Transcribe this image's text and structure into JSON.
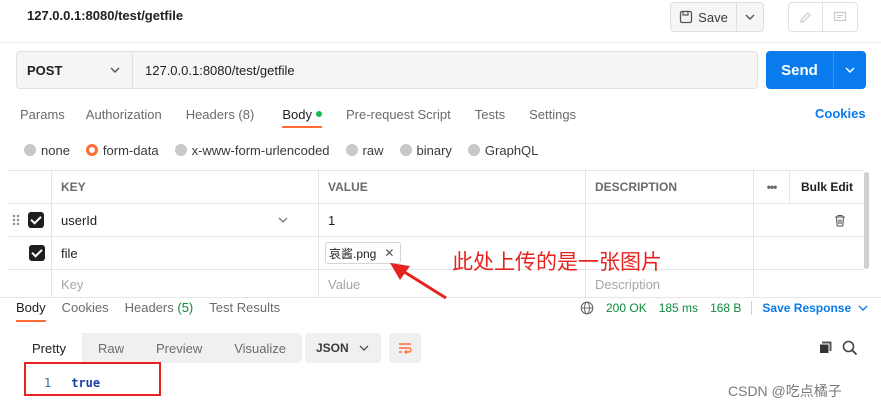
{
  "header": {
    "title": "127.0.0.1:8080/test/getfile",
    "save_label": "Save"
  },
  "request": {
    "method": "POST",
    "url": "127.0.0.1:8080/test/getfile",
    "send_label": "Send"
  },
  "tabs": {
    "items": [
      "Params",
      "Authorization",
      "Headers (8)",
      "Body",
      "Pre-request Script",
      "Tests",
      "Settings"
    ],
    "active": "Body",
    "cookies": "Cookies"
  },
  "body_modes": {
    "items": [
      "none",
      "form-data",
      "x-www-form-urlencoded",
      "raw",
      "binary",
      "GraphQL"
    ],
    "selected": "form-data"
  },
  "table": {
    "headers": {
      "key": "KEY",
      "value": "VALUE",
      "description": "DESCRIPTION",
      "more": "•••",
      "bulk": "Bulk Edit"
    },
    "rows": [
      {
        "key": "userId",
        "value": "1",
        "description": ""
      },
      {
        "key": "file",
        "value": "哀酱.png",
        "description": ""
      }
    ],
    "placeholder": {
      "key": "Key",
      "value": "Value",
      "description": "Description"
    }
  },
  "response": {
    "tabs": [
      "Body",
      "Cookies",
      "Headers",
      "Test Results"
    ],
    "headers_count": "(5)",
    "status": "200 OK",
    "time": "185 ms",
    "size": "168 B",
    "save_response": "Save Response",
    "view_tabs": [
      "Pretty",
      "Raw",
      "Preview",
      "Visualize"
    ],
    "format": "JSON",
    "line_number": "1",
    "body": "true"
  },
  "annotation": "此处上传的是一张图片",
  "watermark": "CSDN @吃点橘子",
  "colors": {
    "accent": "#ff6c37",
    "send": "#097bed",
    "status_ok": "#0c8a3c",
    "annotation": "#e8231f"
  }
}
